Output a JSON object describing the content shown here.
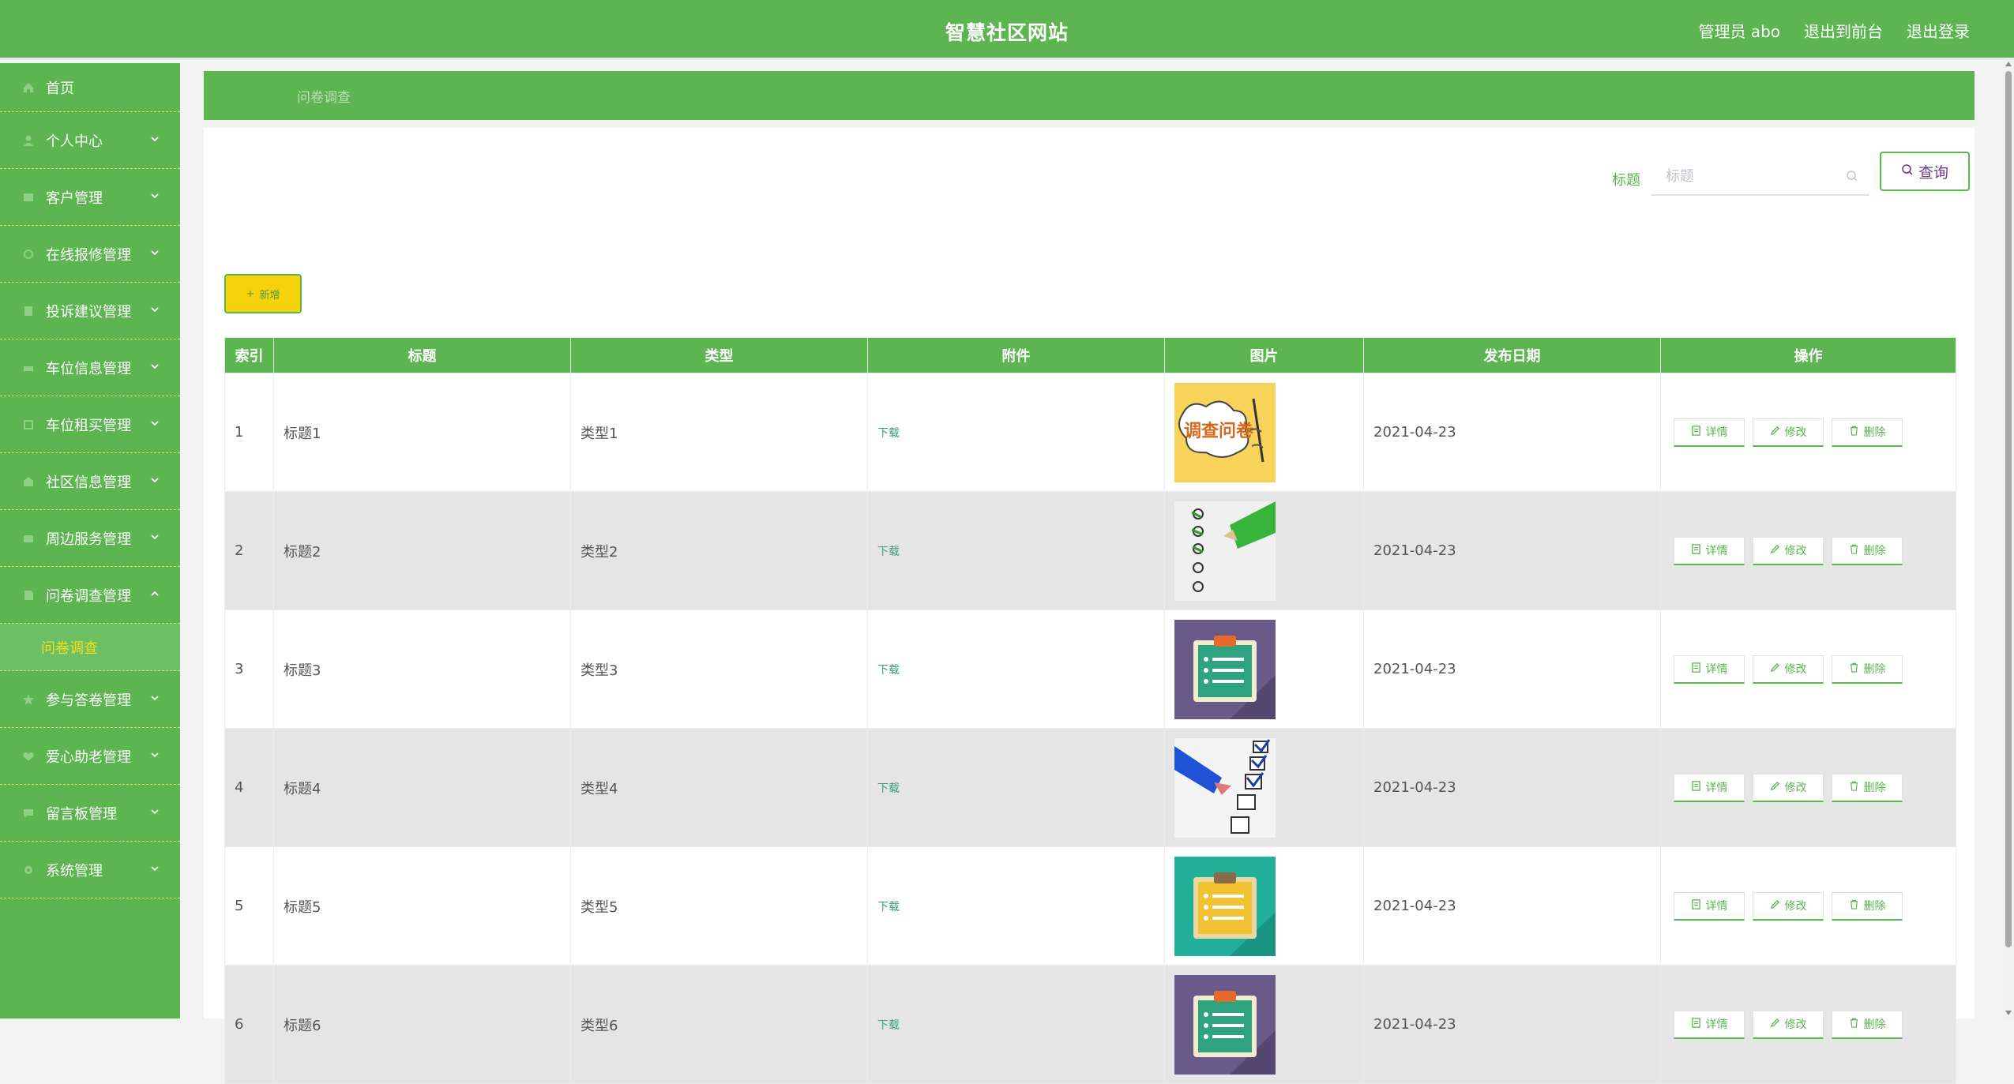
{
  "header": {
    "site_title": "智慧社区网站",
    "user_label": "管理员 abo",
    "to_front": "退出到前台",
    "logout": "退出登录"
  },
  "sidebar": {
    "items": [
      {
        "label": "首页",
        "icon": "home-icon"
      },
      {
        "label": "个人中心",
        "icon": "user-icon"
      },
      {
        "label": "客户管理",
        "icon": "customer-icon"
      },
      {
        "label": "在线报修管理",
        "icon": "repair-icon"
      },
      {
        "label": "投诉建议管理",
        "icon": "complaint-icon"
      },
      {
        "label": "车位信息管理",
        "icon": "parking-icon"
      },
      {
        "label": "车位租买管理",
        "icon": "rent-icon"
      },
      {
        "label": "社区信息管理",
        "icon": "community-icon"
      },
      {
        "label": "周边服务管理",
        "icon": "service-icon"
      },
      {
        "label": "问卷调查管理",
        "icon": "survey-icon"
      },
      {
        "label": "参与答卷管理",
        "icon": "answer-icon"
      },
      {
        "label": "爱心助老管理",
        "icon": "elder-icon"
      },
      {
        "label": "留言板管理",
        "icon": "message-icon"
      },
      {
        "label": "系统管理",
        "icon": "system-icon"
      }
    ],
    "active_sub": "问卷调查"
  },
  "breadcrumb": {
    "current": "问卷调查"
  },
  "search": {
    "label": "标题",
    "placeholder": "标题",
    "button": "查询"
  },
  "toolbar": {
    "add": "新增"
  },
  "table": {
    "headers": [
      "索引",
      "标题",
      "类型",
      "附件",
      "图片",
      "发布日期",
      "操作"
    ],
    "download_label": "下载",
    "ops": {
      "detail": "详情",
      "edit": "修改",
      "delete": "删除"
    },
    "rows": [
      {
        "index": "1",
        "title": "标题1",
        "type": "类型1",
        "date": "2021-04-23",
        "image": "survey-sketch"
      },
      {
        "index": "2",
        "title": "标题2",
        "type": "类型2",
        "date": "2021-04-23",
        "image": "checklist-green-pen"
      },
      {
        "index": "3",
        "title": "标题3",
        "type": "类型3",
        "date": "2021-04-23",
        "image": "clipboard-purple"
      },
      {
        "index": "4",
        "title": "标题4",
        "type": "类型4",
        "date": "2021-04-23",
        "image": "checklist-blue-pen"
      },
      {
        "index": "5",
        "title": "标题5",
        "type": "类型5",
        "date": "2021-04-23",
        "image": "clipboard-teal"
      },
      {
        "index": "6",
        "title": "标题6",
        "type": "类型6",
        "date": "2021-04-23",
        "image": "clipboard-purple"
      }
    ]
  },
  "image_text": {
    "survey_sketch": "调查问卷"
  },
  "colors": {
    "primary": "#5cb551",
    "accent": "#f5d20c",
    "active_sub": "#f5df1d"
  }
}
